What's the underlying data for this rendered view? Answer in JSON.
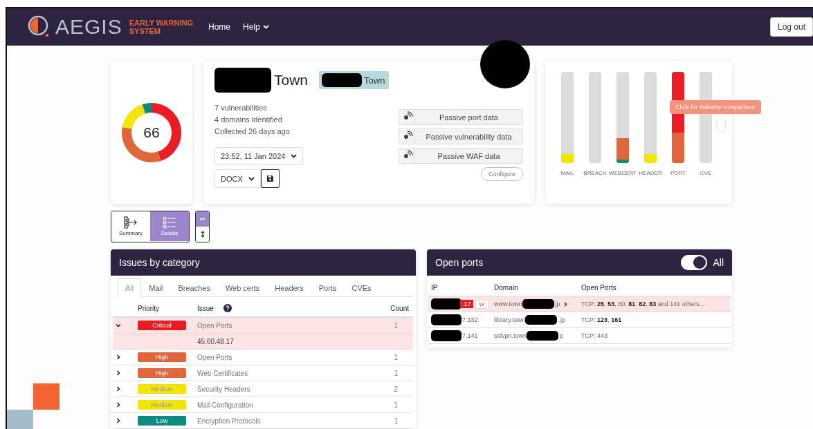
{
  "header": {
    "brand": "AEGIS",
    "tagline_1": "EARLY WARNING",
    "tagline_2": "SYSTEM",
    "nav": [
      {
        "label": "Home",
        "dropdown": false
      },
      {
        "label": "Help",
        "dropdown": true
      }
    ],
    "logout": "Log out"
  },
  "score": {
    "value": "66",
    "segments": [
      {
        "color": "#ec1c24"
      },
      {
        "color": "#e0663c"
      },
      {
        "color": "#f5e400"
      },
      {
        "color": "#0f8a80"
      }
    ]
  },
  "target": {
    "name": "Town",
    "tag": "Town",
    "stats": [
      "7 vulnerabilities",
      "4 domains identified",
      "Collected 26 days ago"
    ],
    "date": "23:52, 11 Jan 2024",
    "format": "DOCX",
    "sources": [
      "Passive port data",
      "Passive vulnerability data",
      "Passive WAF data"
    ],
    "configure": "Configure"
  },
  "categories": {
    "bars": [
      {
        "label": "MAIL",
        "segments": [
          {
            "color": "#f5e400",
            "level": 0.1
          }
        ]
      },
      {
        "label": "BREACH"
      },
      {
        "label": "WEBCERT",
        "segments": [
          {
            "color": "#0f8a80",
            "level": 0.04
          },
          {
            "color": "#e0663c",
            "level": 0.23
          }
        ]
      },
      {
        "label": "HEADER",
        "segments": [
          {
            "color": "#f5e400",
            "level": 0.1
          }
        ]
      },
      {
        "label": "PORT",
        "segments": [
          {
            "color": "#e0663c",
            "level": 0.33
          },
          {
            "color": "#ec1c24",
            "level": 0.67
          }
        ]
      },
      {
        "label": "CVE"
      }
    ],
    "tooltip": "Click for industry comparison"
  },
  "views": [
    {
      "label": "Summary",
      "selected": false
    },
    {
      "label": "Details",
      "selected": true
    }
  ],
  "layout_toggle": [
    {
      "selected": true
    },
    {
      "selected": false
    }
  ],
  "issues": {
    "title": "Issues by category",
    "tabs": [
      {
        "label": "All",
        "selected": true
      },
      {
        "label": "Mail",
        "selected": false
      },
      {
        "label": "Breaches",
        "selected": false
      },
      {
        "label": "Web certs",
        "selected": false
      },
      {
        "label": "Headers",
        "selected": false
      },
      {
        "label": "Ports",
        "selected": false
      },
      {
        "label": "CVEs",
        "selected": false
      }
    ],
    "columns": [
      "Priority",
      "Issue",
      "Count"
    ],
    "rows": [
      {
        "priority": "Critical",
        "color": "#ec1c24",
        "issue": "Open Ports",
        "count": "1",
        "expanded": true,
        "detail": "45.60.48.17"
      },
      {
        "priority": "High",
        "color": "#e0663c",
        "issue": "Open Ports",
        "count": "1",
        "expanded": false
      },
      {
        "priority": "High",
        "color": "#e0663c",
        "issue": "Web Certificates",
        "count": "1",
        "expanded": false
      },
      {
        "priority": "Medium",
        "color": "#f5e400",
        "issue": "Security Headers",
        "count": "2",
        "expanded": false
      },
      {
        "priority": "Medium",
        "color": "#f5e400",
        "issue": "Mail Configuration",
        "count": "1",
        "expanded": false
      },
      {
        "priority": "Low",
        "color": "#0f8a80",
        "issue": "Encryption Protocols",
        "count": "1",
        "expanded": false
      }
    ]
  },
  "ports": {
    "title": "Open ports",
    "toggle": {
      "on": true,
      "label": "All"
    },
    "columns": [
      "IP",
      "Domain",
      "Open Ports"
    ],
    "rows": [
      {
        "kind": "critical",
        "ip": ".17",
        "badge": "W",
        "domain_start": "www.town",
        "domain_end": "jp",
        "ports": "TCP: **25**, **53**, 80, **81**, **82**, **83** and 141 others..."
      },
      {
        "kind": "normal",
        "ip": "7.132",
        "domain_start": "library.town",
        "domain_end": ".jp",
        "ports": "TCP: **123**, **161**"
      },
      {
        "kind": "normal",
        "ip": "7.141",
        "domain_start": "sslvpn.town",
        "domain_end": "p",
        "ports": "TCP: 443"
      }
    ]
  }
}
